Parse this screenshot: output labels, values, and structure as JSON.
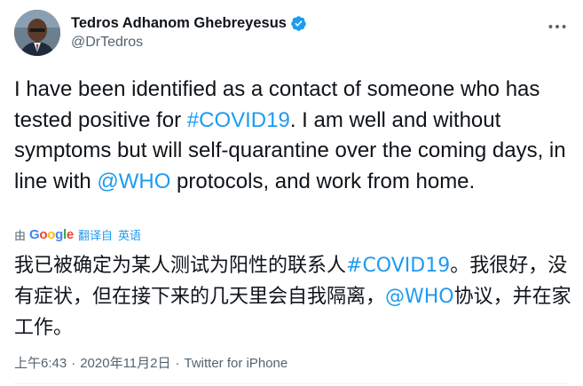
{
  "author": {
    "display_name": "Tedros Adhanom Ghebreyesus",
    "handle": "@DrTedros",
    "verified": true,
    "avatar": "person-photo"
  },
  "tweet": {
    "text_en_1": "I have been identified as a contact of someone who has tested positive for ",
    "hashtag": "#COVID19",
    "text_en_2": ". I am well and without symptoms but will self-quarantine over the coming days, in line with ",
    "mention": "@WHO",
    "text_en_3": " protocols, and work from home."
  },
  "translation": {
    "by": "由",
    "provider": "Google",
    "action": "翻译自",
    "language": "英语",
    "text_zh_1": "我已被确定为某人测试为阳性的联系人",
    "hashtag": "#COVID19",
    "text_zh_2": "。我很好，没有症状，但在接下来的几天里会自我隔离，",
    "mention": "@WHO",
    "text_zh_3": "协议，并在家工作。"
  },
  "meta": {
    "time": "上午6:43",
    "separator_1": "·",
    "date": "2020年11月2日",
    "separator_2": "·",
    "source": "Twitter for iPhone"
  },
  "icons": {
    "verified": "verified-badge-icon",
    "more": "more-options-icon"
  },
  "colors": {
    "link": "#1d9bf0",
    "text": "#0f1419",
    "secondary": "#536471",
    "google_blue": "#4285f4",
    "google_red": "#ea4335",
    "google_yellow": "#fbbc05",
    "google_green": "#34a853"
  }
}
